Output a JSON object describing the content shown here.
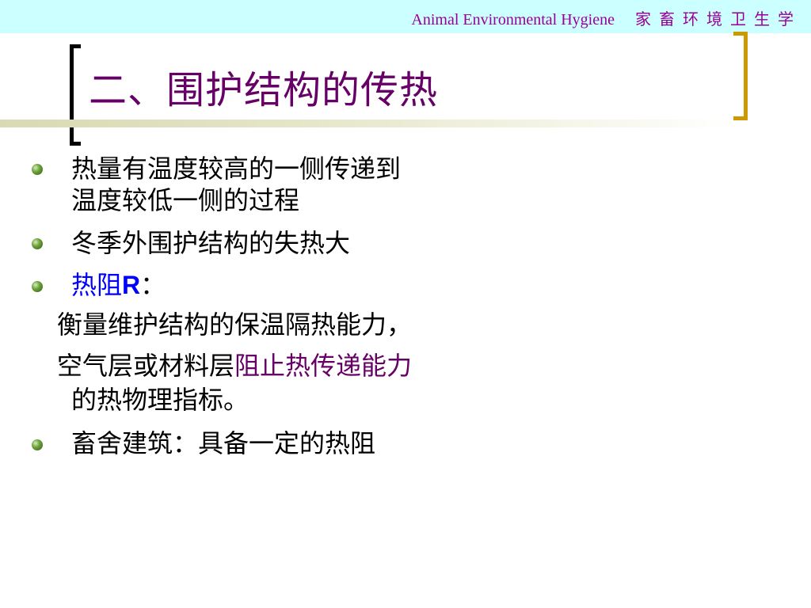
{
  "header": {
    "english": "Animal Environmental Hygiene",
    "chinese": "家畜环境卫生学"
  },
  "slide": {
    "title": "二、围护结构的传热",
    "items": [
      {
        "line1": "热量有温度较高的一侧传递到",
        "line2": "温度较低一侧的过程"
      },
      {
        "text": "冬季外围护结构的失热大"
      },
      {
        "prefix": "热阻",
        "symbol": "R",
        "suffix": "："
      },
      {
        "text": "衡量维护结构的保温隔热能力，"
      },
      {
        "prefix": "空气层或材料层",
        "highlight": "阻止热传递能力",
        "line2": "的热物理指标。"
      },
      {
        "text": "畜舍建筑：具备一定的热阻"
      }
    ]
  },
  "colors": {
    "header_band": "#ccffff",
    "header_text": "#990099",
    "title": "#660066",
    "bracket_left": "#000000",
    "bracket_right": "#cc9900",
    "bullet": "#6fa33b",
    "term_blue": "#0000ff",
    "highlight_purple": "#660066"
  }
}
